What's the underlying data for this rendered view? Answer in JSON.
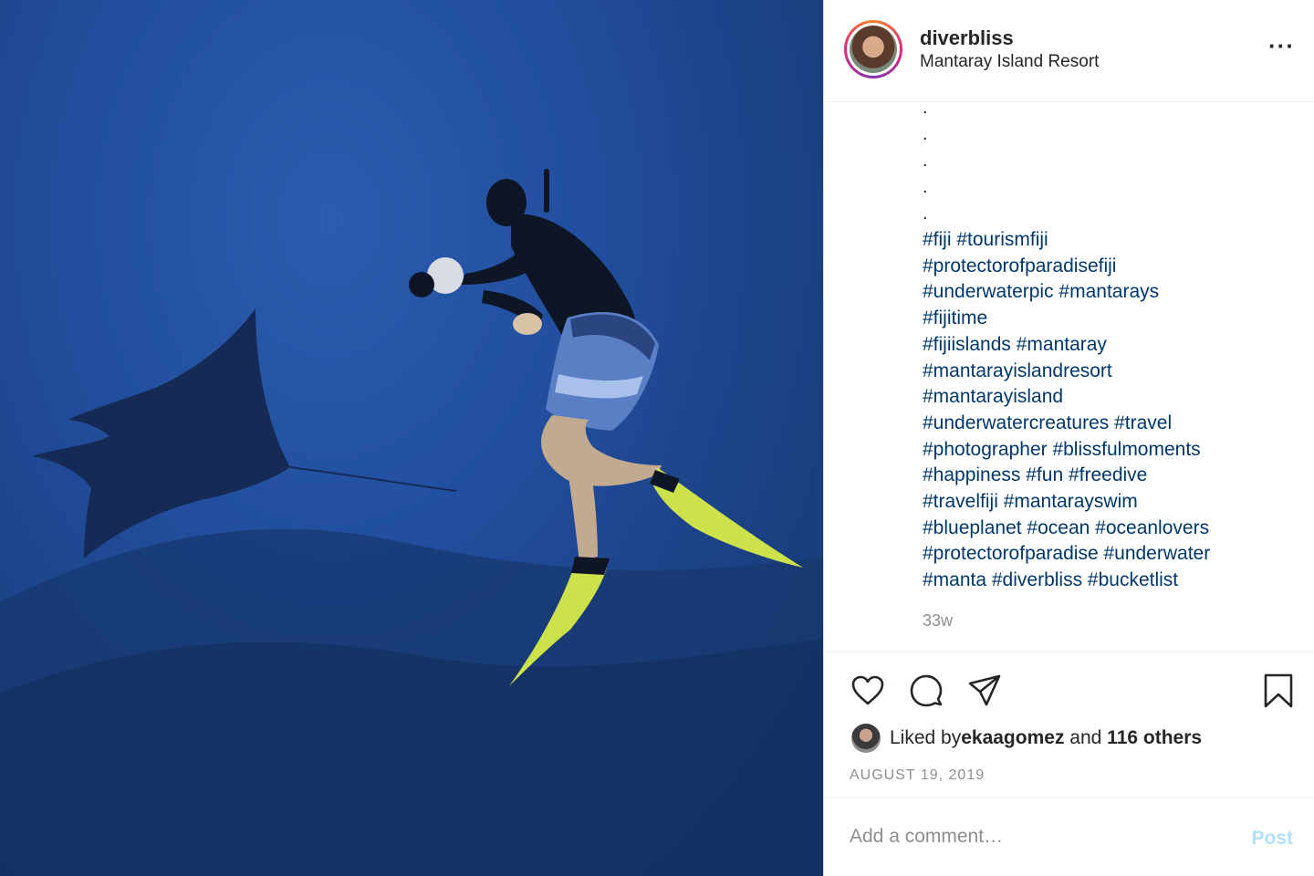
{
  "post": {
    "username": "diverbliss",
    "location": "Mantaray Island Resort",
    "more_icon": "more-horizontal-icon",
    "caption_dots": [
      ".",
      ".",
      ".",
      ".",
      "."
    ],
    "hashtag_lines": [
      "#fiji #tourismfiji",
      "#protectorofparadisefiji",
      "#underwaterpic #mantarays",
      "#fijitime",
      "#fijiislands #mantaray",
      "#mantarayislandresort",
      "#mantarayisland",
      "#underwatercreatures #travel",
      "#photographer #blissfulmoments",
      "#happiness #fun #freedive",
      "#travelfiji #mantarayswim",
      "#blueplanet #ocean #oceanlovers",
      "#protectorofparadise #underwater",
      "#manta #diverbliss #bucketlist"
    ],
    "age": "33w"
  },
  "actions": {
    "icons": [
      "heart-icon",
      "comment-icon",
      "share-icon",
      "bookmark-icon"
    ],
    "liked_prefix": "Liked by ",
    "liked_user": "ekaagomez",
    "liked_and": " and ",
    "liked_others": "116 others",
    "date": "AUGUST 19, 2019"
  },
  "comment": {
    "placeholder": "Add a comment…",
    "post_label": "Post"
  },
  "colors": {
    "hashtag": "#00376b",
    "muted": "#8e8e8e",
    "post_disabled": "#b2dffc",
    "water": "#1f4a94"
  }
}
